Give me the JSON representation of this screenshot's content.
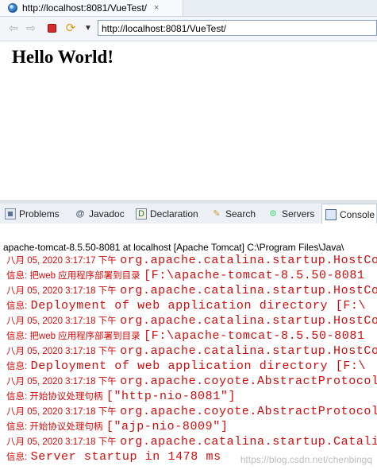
{
  "browser": {
    "tab_title": "http://localhost:8081/VueTest/",
    "tab_close": "×",
    "url": "http://localhost:8081/VueTest/",
    "back_icon": "⇦",
    "forward_icon": "⇨",
    "refresh_icon": "⟳",
    "menu_icon": "▼"
  },
  "page": {
    "heading": "Hello World!"
  },
  "views": {
    "tabs": [
      {
        "label": "Problems",
        "icon": "problems-icon"
      },
      {
        "label": "Javadoc",
        "icon": "at-icon",
        "glyph": "@"
      },
      {
        "label": "Declaration",
        "icon": "declaration-icon",
        "glyph": "D"
      },
      {
        "label": "Search",
        "icon": "search-icon",
        "glyph": "✎"
      },
      {
        "label": "Servers",
        "icon": "servers-icon",
        "glyph": "⚙"
      },
      {
        "label": "Console",
        "icon": "console-icon",
        "active": true
      }
    ]
  },
  "console": {
    "header": "apache-tomcat-8.5.50-8081 at localhost [Apache Tomcat] C:\\Program Files\\Java\\",
    "lines": [
      {
        "prefix": "八月 05, 2020 3:17:17 下午",
        "msg": "org.apache.catalina.startup.HostConfig"
      },
      {
        "prefix": "信息: 把web 应用程序部署到目录",
        "msg": "[F:\\apache-tomcat-8.5.50-8081"
      },
      {
        "prefix": "八月 05, 2020 3:17:18 下午",
        "msg": "org.apache.catalina.startup.HostConfig"
      },
      {
        "prefix": "信息:",
        "msg": "Deployment of web application directory [F:\\"
      },
      {
        "prefix": "八月 05, 2020 3:17:18 下午",
        "msg": "org.apache.catalina.startup.HostConfig"
      },
      {
        "prefix": "信息: 把web 应用程序部署到目录",
        "msg": "[F:\\apache-tomcat-8.5.50-8081"
      },
      {
        "prefix": "八月 05, 2020 3:17:18 下午",
        "msg": "org.apache.catalina.startup.HostConfig"
      },
      {
        "prefix": "信息:",
        "msg": "Deployment of web application directory [F:\\"
      },
      {
        "prefix": "八月 05, 2020 3:17:18 下午",
        "msg": "org.apache.coyote.AbstractProtocol"
      },
      {
        "prefix": "信息: 开始协议处理句柄",
        "msg": "[\"http-nio-8081\"]"
      },
      {
        "prefix": "八月 05, 2020 3:17:18 下午",
        "msg": "org.apache.coyote.AbstractProtocol"
      },
      {
        "prefix": "信息: 开始协议处理句柄",
        "msg": "[\"ajp-nio-8009\"]"
      },
      {
        "prefix": "八月 05, 2020 3:17:18 下午",
        "msg": "org.apache.catalina.startup.Catalina"
      },
      {
        "prefix": "信息:",
        "msg": "Server startup in 1478 ms"
      }
    ]
  },
  "watermark": "https://blog.csdn.net/chenbingq",
  "colors": {
    "log_red": "#d10b0b",
    "tab_bg": "#ecf0f5"
  }
}
